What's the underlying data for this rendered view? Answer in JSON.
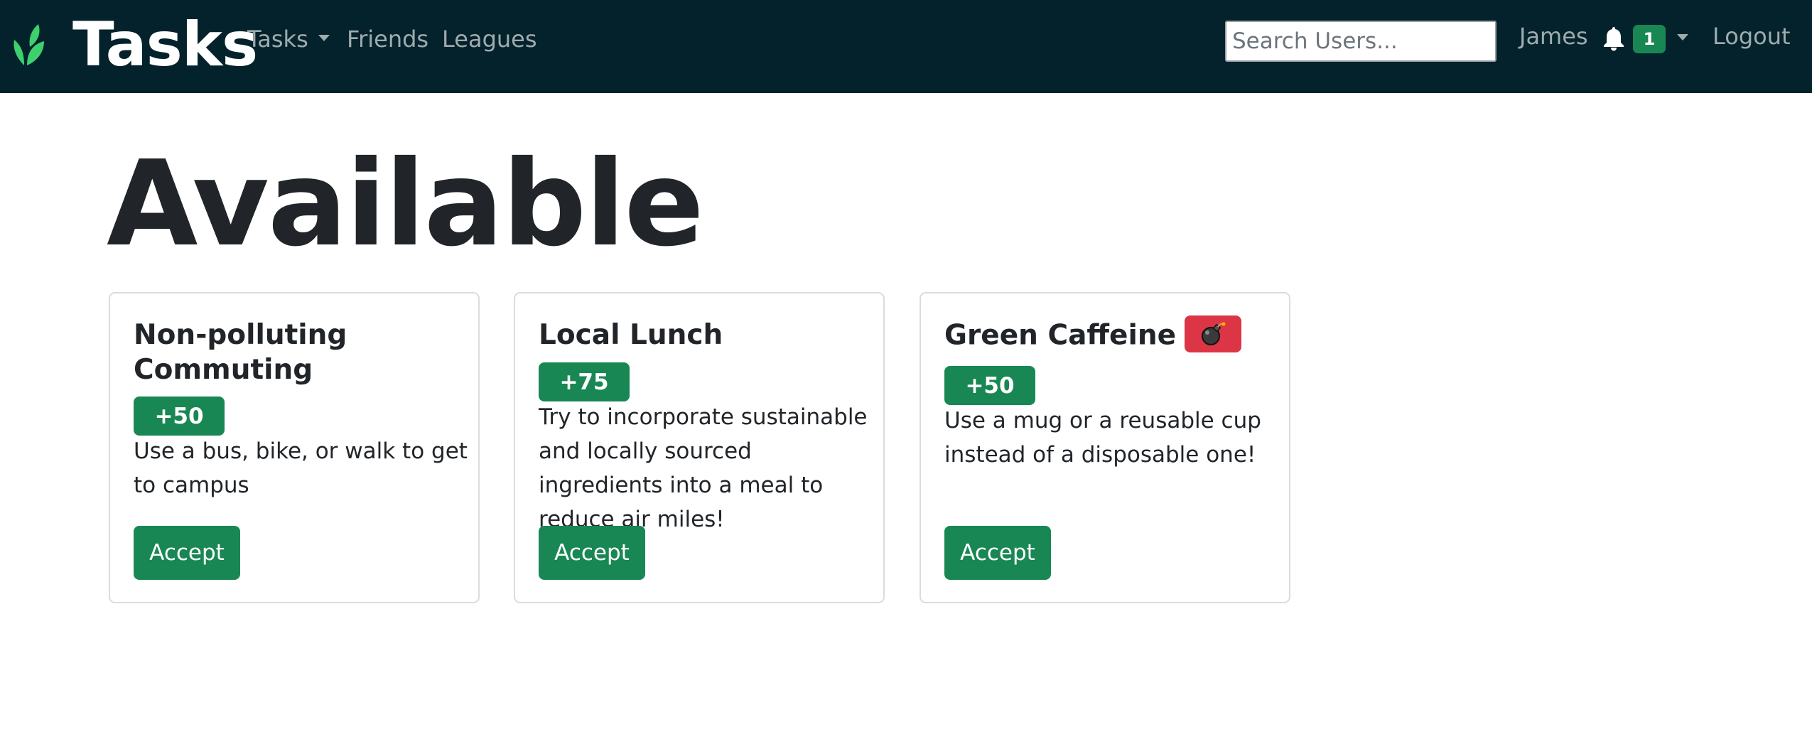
{
  "navbar": {
    "brand": "Tasks",
    "menu": [
      {
        "label": "Tasks",
        "has_dropdown": true
      },
      {
        "label": "Friends"
      },
      {
        "label": "Leagues"
      }
    ],
    "search_placeholder": "Search Users...",
    "user_name": "James",
    "notification_count": "1",
    "logout_label": "Logout",
    "colors": {
      "background": "#03222c",
      "accent": "#198754",
      "logo": "#3ecf6e"
    }
  },
  "main": {
    "title": "Available",
    "cards": [
      {
        "title": "Non-polluting Commuting",
        "points": "+50",
        "description": "Use a bus, bike, or walk to get to campus",
        "button_label": "Accept"
      },
      {
        "title": "Local Lunch",
        "points": "+75",
        "description": "Try to incorporate sustainable and locally sourced ingredients into a meal to reduce air miles!",
        "button_label": "Accept"
      },
      {
        "title": "Green Caffeine",
        "has_bomb_badge": true,
        "bomb_icon": "bomb-icon",
        "points": "+50",
        "description": "Use a mug or a reusable cup instead of a disposable one!",
        "button_label": "Accept"
      }
    ],
    "colors": {
      "badge": "#198754",
      "danger": "#dc3545",
      "card_border": "#d9dcdf"
    }
  }
}
